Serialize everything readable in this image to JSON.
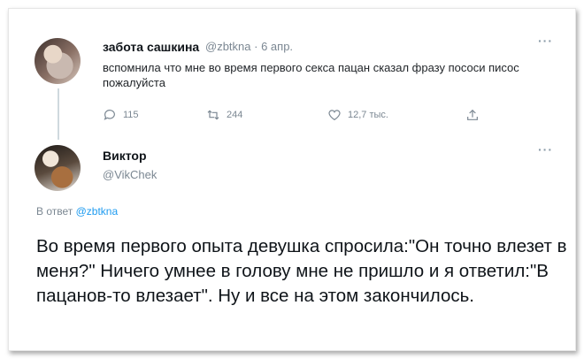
{
  "tweet1": {
    "author_name": "забота сашкина",
    "handle": "@zbtkna",
    "separator": "·",
    "date": "6 апр.",
    "text": "вспомнила что мне во время первого секса пацан сказал фразу пососи писос пожалуйста",
    "stats": {
      "replies": "115",
      "retweets": "244",
      "likes": "12,7 тыс."
    },
    "icons": [
      "reply-icon",
      "retweet-icon",
      "like-icon",
      "share-icon",
      "more-icon"
    ]
  },
  "tweet2": {
    "author_name": "Виктор",
    "handle": "@VikChek",
    "reply_prefix": "В ответ",
    "reply_mention": "@zbtkna",
    "text": "Во время первого опыта девушка спросила:\"Он точно влезет в меня?\" Ничего умнее в голову мне не пришло и я ответил:\"В пацанов-то влезает\". Ну и все на этом закончилось.",
    "icons": [
      "more-icon"
    ]
  },
  "colors": {
    "text": "#0f1419",
    "secondary": "#7b8792",
    "link": "#1d9bf0",
    "thread_line": "#cfd9de"
  }
}
